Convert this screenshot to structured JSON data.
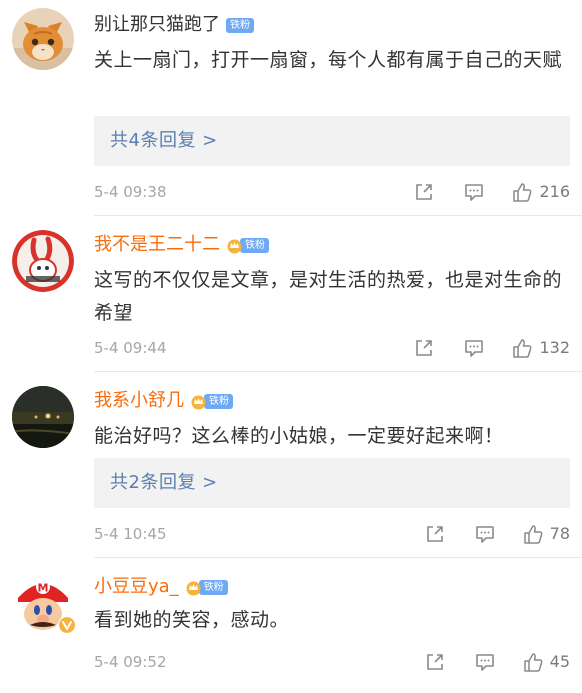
{
  "comments": [
    {
      "avatar": "orange-cat-avatar",
      "username": "别让那只猫跑了",
      "name_style": "normal",
      "badge": {
        "icon": "",
        "label": "铁粉"
      },
      "text": "关上一扇门，打开一扇窗，每个人都有属于自己的天赋",
      "replies_label": "共4条回复 >",
      "timestamp": "5-4 09:38",
      "likes": "216"
    },
    {
      "avatar": "rabbit-avatar",
      "username": "我不是王二十二",
      "name_style": "orange",
      "badge": {
        "icon": "crown-icon",
        "label": "铁粉"
      },
      "text": "这写的不仅仅是文章，是对生活的热爱，也是对生命的希望",
      "timestamp": "5-4 09:44",
      "likes": "132"
    },
    {
      "avatar": "night-scene-avatar",
      "username": "我系小舒几",
      "name_style": "orange",
      "badge": {
        "icon": "crown-icon",
        "label": "铁粉"
      },
      "text": "能治好吗？这么棒的小姑娘，一定要好起来啊！",
      "replies_label": "共2条回复 >",
      "timestamp": "5-4 10:45",
      "likes": "78"
    },
    {
      "avatar": "mario-avatar",
      "username": "小豆豆ya_",
      "name_style": "orange",
      "badge": {
        "icon": "crown-icon",
        "label": "铁粉"
      },
      "verified_icon": "verified-v-icon",
      "text": "看到她的笑容，感动。",
      "timestamp": "5-4 09:52",
      "likes": "45"
    }
  ],
  "colors": {
    "username_orange": "#f86e0d",
    "reply_link": "#5b7fb0",
    "badge_blue": "#6fa8f5",
    "timestamp_gray": "#a6a6a6"
  }
}
